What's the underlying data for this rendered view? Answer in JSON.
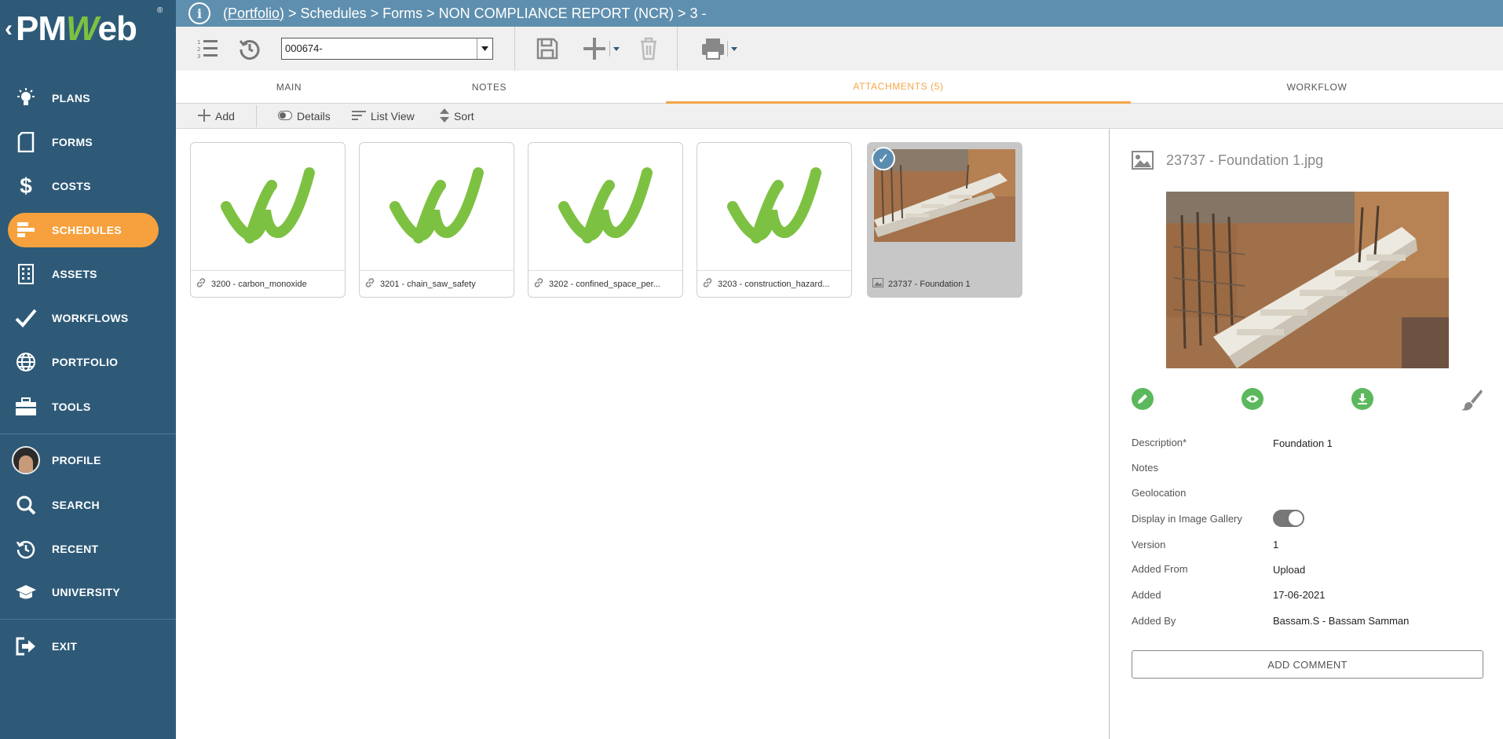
{
  "sidebar": {
    "brand": "PMWeb",
    "items": [
      {
        "label": "PLANS",
        "icon": "lightbulb-icon"
      },
      {
        "label": "FORMS",
        "icon": "forms-icon"
      },
      {
        "label": "COSTS",
        "icon": "dollar-icon"
      },
      {
        "label": "SCHEDULES",
        "icon": "schedule-icon",
        "active": true
      },
      {
        "label": "ASSETS",
        "icon": "building-icon"
      },
      {
        "label": "WORKFLOWS",
        "icon": "checkmark-icon"
      },
      {
        "label": "PORTFOLIO",
        "icon": "globe-icon"
      },
      {
        "label": "TOOLS",
        "icon": "briefcase-icon"
      },
      {
        "label": "PROFILE",
        "icon": "avatar"
      },
      {
        "label": "SEARCH",
        "icon": "search-icon"
      },
      {
        "label": "RECENT",
        "icon": "recent-icon"
      },
      {
        "label": "UNIVERSITY",
        "icon": "graduation-cap-icon"
      },
      {
        "label": "EXIT",
        "icon": "exit-icon"
      }
    ]
  },
  "breadcrumb": {
    "link": "(Portfolio)",
    "rest": " > Schedules > Forms > NON COMPLIANCE REPORT (NCR) > 3 -"
  },
  "toolbar": {
    "record_value": "000674-"
  },
  "tabs": [
    {
      "label": "MAIN"
    },
    {
      "label": "NOTES"
    },
    {
      "label": "ATTACHMENTS (5)",
      "active": true
    },
    {
      "label": "WORKFLOW"
    }
  ],
  "subbar": {
    "add": "Add",
    "details": "Details",
    "list_view": "List View",
    "sort": "Sort"
  },
  "attachments": [
    {
      "caption": "3200 - carbon_monoxide",
      "type": "link"
    },
    {
      "caption": "3201 - chain_saw_safety",
      "type": "link"
    },
    {
      "caption": "3202 - confined_space_per...",
      "type": "link"
    },
    {
      "caption": "3203 - construction_hazard...",
      "type": "link"
    },
    {
      "caption": "23737 - Foundation 1",
      "type": "image",
      "selected": true
    }
  ],
  "detail": {
    "title": "23737 - Foundation 1.jpg",
    "fields": [
      {
        "label": "Description*",
        "value": "Foundation 1"
      },
      {
        "label": "Notes",
        "value": ""
      },
      {
        "label": "Geolocation",
        "value": ""
      },
      {
        "label": "Display in Image Gallery",
        "value": "",
        "toggle": true,
        "on": true
      },
      {
        "label": "Version",
        "value": "1"
      },
      {
        "label": "Added From",
        "value": "Upload"
      },
      {
        "label": "Added",
        "value": "17-06-2021"
      },
      {
        "label": "Added By",
        "value": "Bassam.S - Bassam Samman"
      }
    ],
    "add_comment": "ADD COMMENT"
  },
  "colors": {
    "sidebar": "#2e5a78",
    "topbar": "#5f8fae",
    "accent": "#f6a13d",
    "action_green": "#5cb85c",
    "brand_green": "#7dc142"
  }
}
